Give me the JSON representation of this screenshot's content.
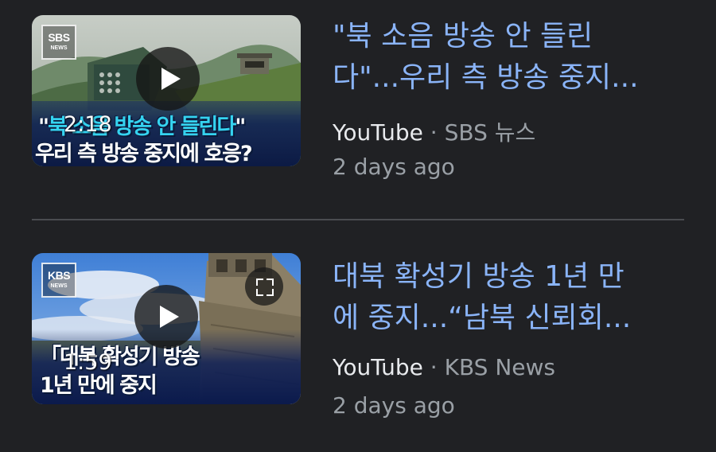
{
  "results": [
    {
      "thumbnail": {
        "logo_big": "SBS",
        "logo_small": "NEWS",
        "caption_line1_quote_open": "\"",
        "caption_line1_highlight": "북 소음 방송 안 들린다",
        "caption_line1_quote_close": "\"",
        "caption_line2": "우리 측 방송 중지에 호응?",
        "duration": "2:18",
        "play_icon": "play-icon"
      },
      "title_line1": "\"북 소음 방송 안 들린",
      "title_line2": "다\"...우리 측 방송 중지...",
      "source": "YouTube",
      "separator": "·",
      "channel": "SBS 뉴스",
      "time": "2 days ago"
    },
    {
      "thumbnail": {
        "logo_big": "KBS",
        "logo_small": "NEWS",
        "caption_line1": "「대북 확성기 방송",
        "caption_line2": "1년 만에 중지",
        "duration": "1:59",
        "play_icon": "play-icon",
        "fullscreen_icon": "fullscreen-icon"
      },
      "title_line1": "대북 확성기 방송 1년 만",
      "title_line2": "에 중지...“남북 신뢰회...",
      "source": "YouTube",
      "separator": "·",
      "channel": "KBS News",
      "time": "2 days ago"
    }
  ],
  "colors": {
    "background": "#202124",
    "title": "#8ab4f8",
    "source": "#e8eaed",
    "secondary": "#9aa0a6",
    "divider": "#4a4c50",
    "caption_highlight": "#35d3f0"
  }
}
